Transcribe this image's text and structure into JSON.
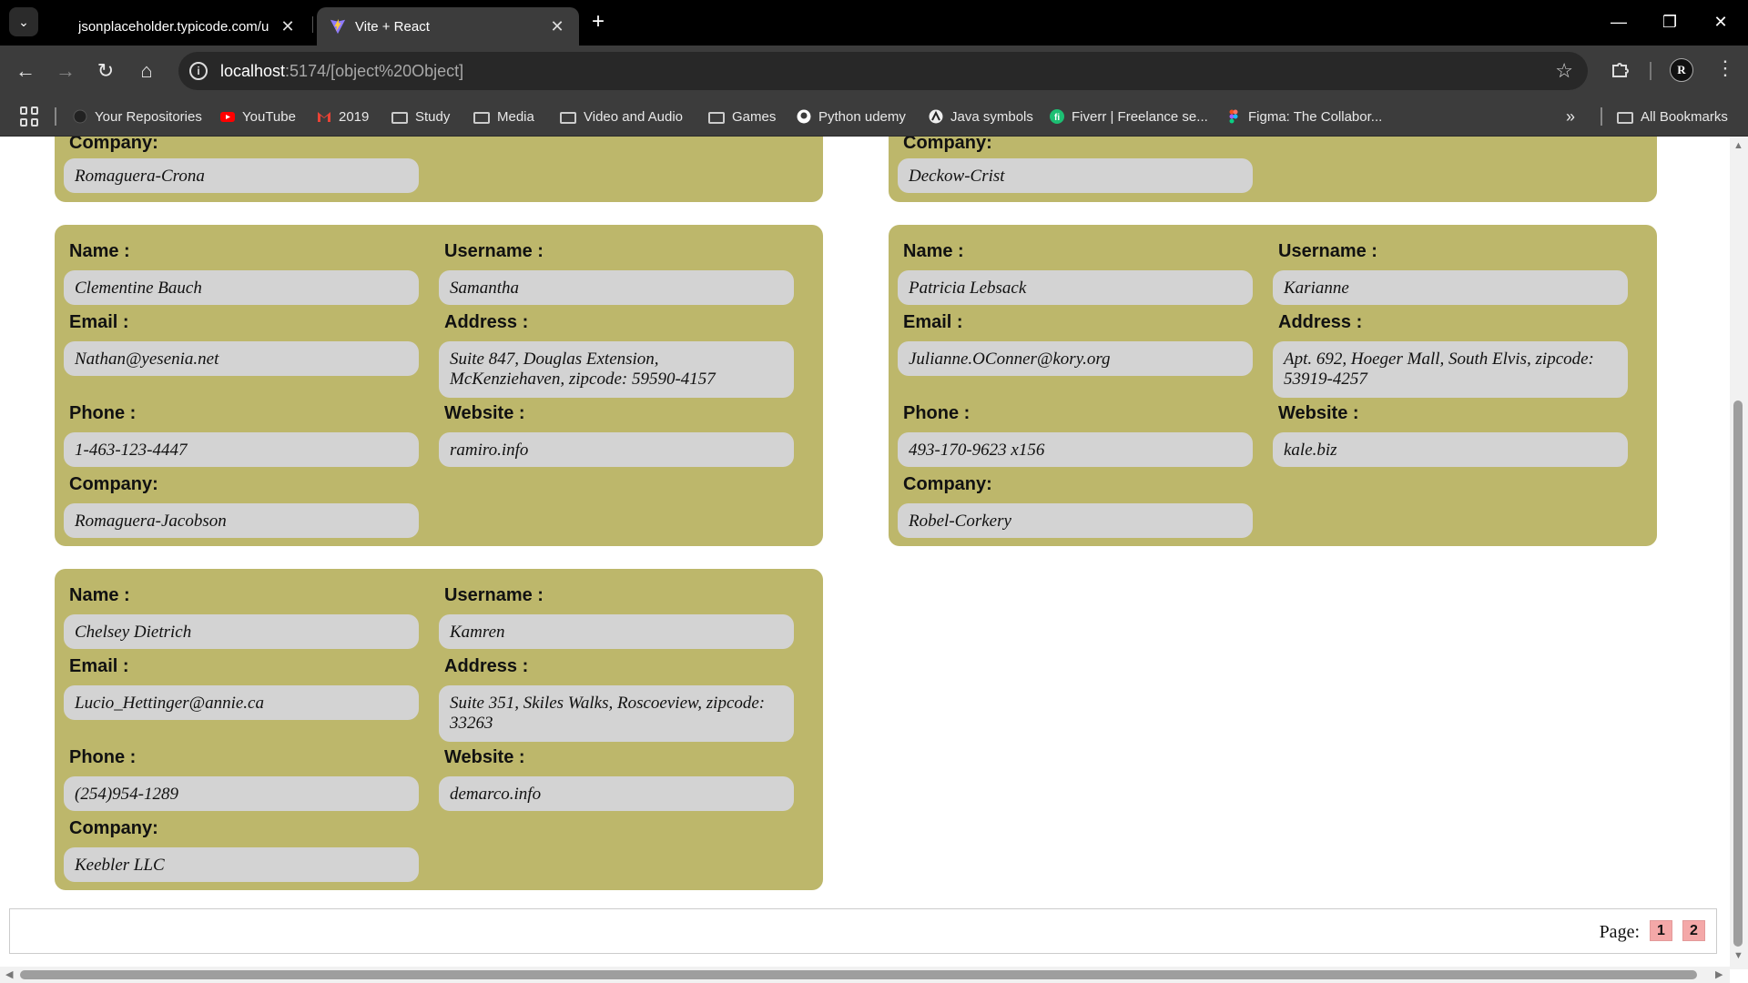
{
  "browser": {
    "tabs": [
      {
        "title": "jsonplaceholder.typicode.com/u",
        "active": false
      },
      {
        "title": "Vite + React",
        "active": true
      }
    ],
    "url_host": "localhost",
    "url_rest": ":5174/[object%20Object]",
    "bookmarks": [
      "Your Repositories",
      "YouTube",
      "2019",
      "Study",
      "Media",
      "Video and Audio",
      "Games",
      "Python udemy",
      "Java symbols",
      "Fiverr | Freelance se...",
      "Figma: The Collabor..."
    ],
    "all_bookmarks": "All Bookmarks",
    "avatar_initial": "R"
  },
  "labels": {
    "name": "Name :",
    "username": "Username :",
    "email": "Email :",
    "address": "Address :",
    "phone": "Phone :",
    "website": "Website :",
    "company": "Company:"
  },
  "partial_cards": [
    {
      "company": "Romaguera-Crona"
    },
    {
      "company": "Deckow-Crist"
    }
  ],
  "users": [
    {
      "name": "Clementine Bauch",
      "username": "Samantha",
      "email": "Nathan@yesenia.net",
      "address_line1": "Suite 847, Douglas Extension,",
      "address_line2": "McKenziehaven, zipcode: 59590-4157",
      "phone": "1-463-123-4447",
      "website": "ramiro.info",
      "company": "Romaguera-Jacobson"
    },
    {
      "name": "Patricia Lebsack",
      "username": "Karianne",
      "email": "Julianne.OConner@kory.org",
      "address_line1": "Apt. 692, Hoeger Mall, South Elvis, zipcode:",
      "address_line2": "53919-4257",
      "phone": "493-170-9623 x156",
      "website": "kale.biz",
      "company": "Robel-Corkery"
    },
    {
      "name": "Chelsey Dietrich",
      "username": "Kamren",
      "email": "Lucio_Hettinger@annie.ca",
      "address_line1": "Suite 351, Skiles Walks, Roscoeview, zipcode:",
      "address_line2": "33263",
      "phone": "(254)954-1289",
      "website": "demarco.info",
      "company": "Keebler LLC"
    }
  ],
  "pagination": {
    "label": "Page:",
    "pages": [
      "1",
      "2"
    ]
  },
  "colors": {
    "card_bg": "#bdb76b",
    "field_bg": "#d3d3d3",
    "page_btn": "#f4a8a8"
  }
}
